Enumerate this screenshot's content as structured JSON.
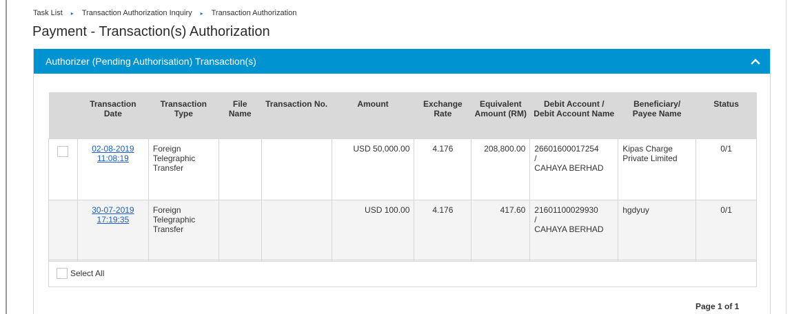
{
  "breadcrumb": [
    "Task List",
    "Transaction Authorization Inquiry",
    "Transaction Authorization"
  ],
  "breadcrumb_separator": "▸",
  "page_title": "Payment - Transaction(s) Authorization",
  "panel": {
    "title": "Authorizer (Pending Authorisation) Transaction(s)",
    "header_color": "#0093d1",
    "collapse_icon": "chevron-up-icon"
  },
  "table": {
    "headers": {
      "transaction_date": "Transaction Date",
      "transaction_type": "Transaction Type",
      "file_name": "File Name",
      "transaction_no": "Transaction No.",
      "amount": "Amount",
      "exchange_rate": "Exchange Rate",
      "equivalent_amount": "Equivalent Amount (RM)",
      "debit_account": "Debit Account / Debit Account Name",
      "beneficiary": "Beneficiary/ Payee Name",
      "status": "Status"
    },
    "rows": [
      {
        "date": "02-08-2019",
        "time": "11:08:19",
        "type": "Foreign Telegraphic Transfer",
        "file_name": "",
        "transaction_no": "",
        "amount": "USD 50,000.00",
        "exchange_rate": "4.176",
        "equivalent_amount": "208,800.00",
        "debit_account_no": "26601600017254",
        "debit_account_sep": "/",
        "debit_account_name": "CAHAYA BERHAD",
        "beneficiary": "Kipas Charge Private Limited",
        "status": "0/1"
      },
      {
        "date": "30-07-2019",
        "time": "17:19:35",
        "type": "Foreign Telegraphic Transfer",
        "file_name": "",
        "transaction_no": "",
        "amount": "USD 100.00",
        "exchange_rate": "4.176",
        "equivalent_amount": "417.60",
        "debit_account_no": "21601100029930",
        "debit_account_sep": "/",
        "debit_account_name": "CAHAYA BERHAD",
        "beneficiary": "hgdyuy",
        "status": "0/1"
      }
    ]
  },
  "select_all_label": "Select All",
  "pagination": "Page 1 of 1"
}
